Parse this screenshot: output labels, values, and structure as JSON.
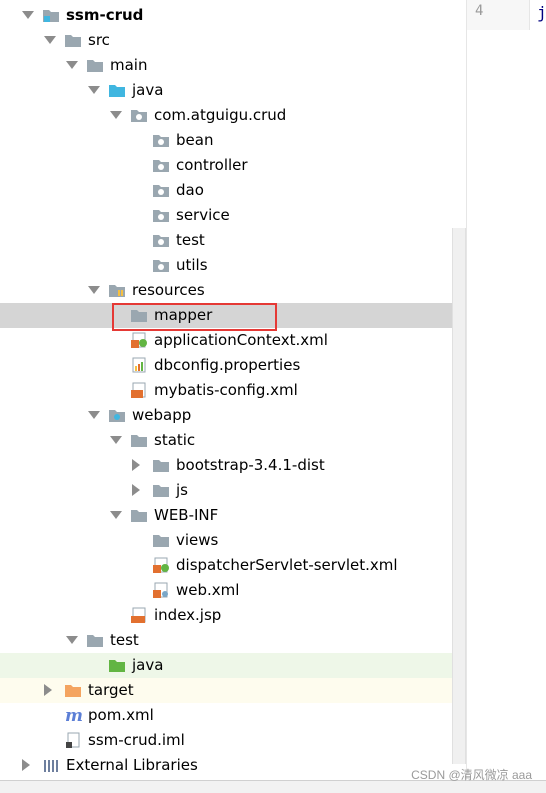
{
  "editor": {
    "line_number": "4",
    "code_fragment": "j"
  },
  "watermark": "CSDN @清风微凉 aaa",
  "tree": [
    {
      "label": "ssm-crud",
      "icon": "module-folder-icon",
      "arrow": "open",
      "indent": 0,
      "bold": true
    },
    {
      "label": "src",
      "icon": "folder-icon",
      "arrow": "open",
      "indent": 1
    },
    {
      "label": "main",
      "icon": "folder-icon",
      "arrow": "open",
      "indent": 2
    },
    {
      "label": "java",
      "icon": "source-folder-icon",
      "arrow": "open",
      "indent": 3
    },
    {
      "label": "com.atguigu.crud",
      "icon": "package-icon",
      "arrow": "open",
      "indent": 4
    },
    {
      "label": "bean",
      "icon": "package-icon",
      "arrow": "none",
      "indent": 5
    },
    {
      "label": "controller",
      "icon": "package-icon",
      "arrow": "none",
      "indent": 5
    },
    {
      "label": "dao",
      "icon": "package-icon",
      "arrow": "none",
      "indent": 5
    },
    {
      "label": "service",
      "icon": "package-icon",
      "arrow": "none",
      "indent": 5
    },
    {
      "label": "test",
      "icon": "package-icon",
      "arrow": "none",
      "indent": 5
    },
    {
      "label": "utils",
      "icon": "package-icon",
      "arrow": "none",
      "indent": 5
    },
    {
      "label": "resources",
      "icon": "resources-folder-icon",
      "arrow": "open",
      "indent": 3
    },
    {
      "label": "mapper",
      "icon": "folder-icon",
      "arrow": "none",
      "indent": 4,
      "selected": true
    },
    {
      "label": "applicationContext.xml",
      "icon": "spring-xml-icon",
      "arrow": "none",
      "indent": 4
    },
    {
      "label": "dbconfig.properties",
      "icon": "properties-file-icon",
      "arrow": "none",
      "indent": 4
    },
    {
      "label": "mybatis-config.xml",
      "icon": "xml-file-icon",
      "arrow": "none",
      "indent": 4
    },
    {
      "label": "webapp",
      "icon": "web-folder-icon",
      "arrow": "open",
      "indent": 3
    },
    {
      "label": "static",
      "icon": "folder-icon",
      "arrow": "open",
      "indent": 4
    },
    {
      "label": "bootstrap-3.4.1-dist",
      "icon": "folder-icon",
      "arrow": "closed",
      "indent": 5
    },
    {
      "label": "js",
      "icon": "folder-icon",
      "arrow": "closed",
      "indent": 5
    },
    {
      "label": "WEB-INF",
      "icon": "folder-icon",
      "arrow": "open",
      "indent": 4
    },
    {
      "label": "views",
      "icon": "folder-icon",
      "arrow": "none",
      "indent": 5
    },
    {
      "label": "dispatcherServlet-servlet.xml",
      "icon": "spring-xml-icon",
      "arrow": "none",
      "indent": 5
    },
    {
      "label": "web.xml",
      "icon": "web-xml-icon",
      "arrow": "none",
      "indent": 5
    },
    {
      "label": "index.jsp",
      "icon": "jsp-file-icon",
      "arrow": "none",
      "indent": 4
    },
    {
      "label": "test",
      "icon": "folder-icon",
      "arrow": "open",
      "indent": 2
    },
    {
      "label": "java",
      "icon": "test-source-folder-icon",
      "arrow": "none",
      "indent": 3,
      "bg": "green"
    },
    {
      "label": "target",
      "icon": "excluded-folder-icon",
      "arrow": "closed",
      "indent": 1,
      "bg": "yellow"
    },
    {
      "label": "pom.xml",
      "icon": "maven-icon",
      "arrow": "none",
      "indent": 1
    },
    {
      "label": "ssm-crud.iml",
      "icon": "iml-file-icon",
      "arrow": "none",
      "indent": 1
    },
    {
      "label": "External Libraries",
      "icon": "libraries-icon",
      "arrow": "closed",
      "indent": 0
    }
  ]
}
